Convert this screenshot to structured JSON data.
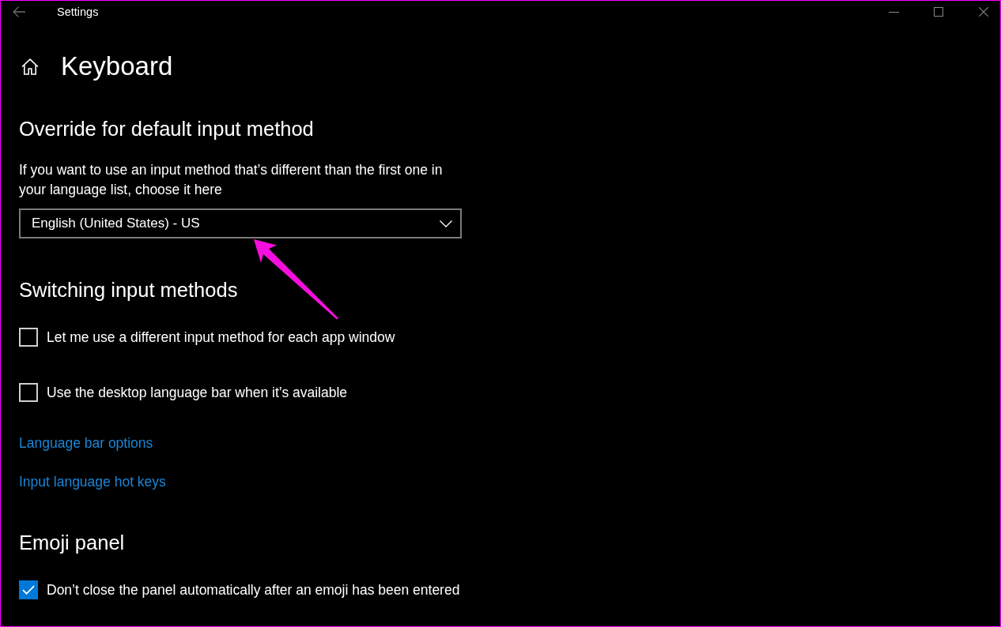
{
  "window": {
    "title": "Settings"
  },
  "page": {
    "title": "Keyboard"
  },
  "sections": [
    {
      "heading": "Override for default input method",
      "items": [
        {
          "kind": "description",
          "text": "If you want to use an input method that’s different than the first one in your language list, choose it here"
        },
        {
          "kind": "dropdown",
          "value": "English (United States) - US"
        }
      ]
    },
    {
      "heading": "Switching input methods",
      "items": [
        {
          "kind": "checkbox",
          "label": "Let me use a different input method for each app window",
          "checked": false
        },
        {
          "kind": "checkbox",
          "label": "Use the desktop language bar when it’s available",
          "checked": false
        },
        {
          "kind": "link",
          "label": "Language bar options"
        },
        {
          "kind": "link",
          "label": "Input language hot keys"
        }
      ]
    },
    {
      "heading": "Emoji panel",
      "items": [
        {
          "kind": "checkbox",
          "label": "Don’t close the panel automatically after an emoji has been entered",
          "checked": true
        }
      ]
    }
  ]
}
